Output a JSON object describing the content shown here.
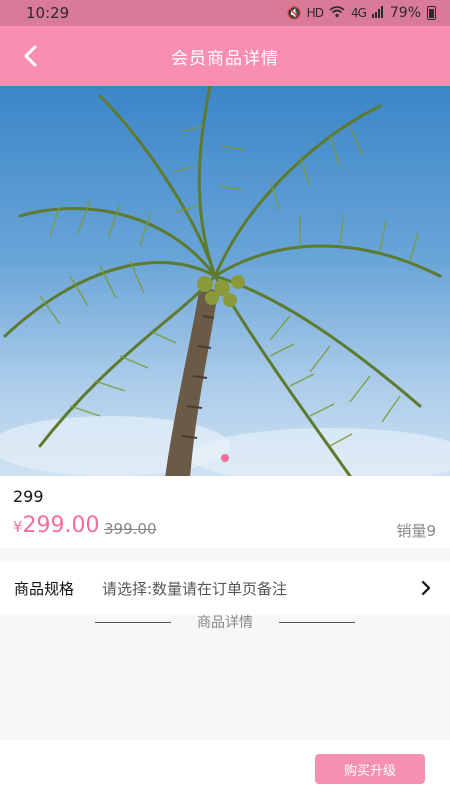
{
  "status_bar": {
    "time": "10:29",
    "network": "HD",
    "signal": "4G",
    "battery": "79%"
  },
  "header": {
    "title": "会员商品详情",
    "back_icon": "chevron-left-icon"
  },
  "colors": {
    "header_bg": "#f88fb1",
    "accent": "#f46e9b",
    "button_bg": "#f690b1"
  },
  "product": {
    "name": "299",
    "currency": "¥",
    "price": "299.00",
    "original_price": "399.00",
    "sales": "销量9"
  },
  "carousel": {
    "slides": 1,
    "active": 1
  },
  "spec": {
    "label": "商品规格",
    "value": "请选择:数量请在订单页备注"
  },
  "detail": {
    "title": "商品详情"
  },
  "footer": {
    "buy_label": "购买升级"
  }
}
